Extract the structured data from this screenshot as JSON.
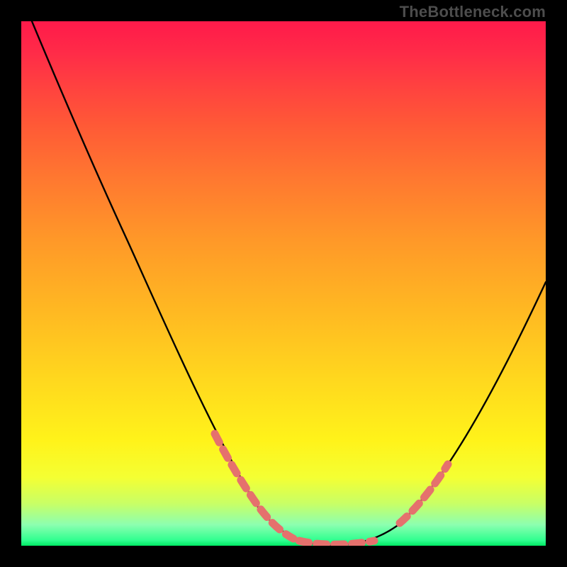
{
  "attribution": "TheBottleneck.com",
  "chart_data": {
    "type": "line",
    "title": "",
    "xlabel": "",
    "ylabel": "",
    "xlim": [
      0,
      100
    ],
    "ylim": [
      0,
      100
    ],
    "grid": false,
    "legend": false,
    "series": [
      {
        "name": "bottleneck-curve",
        "color": "#000000",
        "x": [
          2,
          5,
          10,
          15,
          20,
          25,
          30,
          35,
          40,
          45,
          50,
          53,
          56,
          60,
          65,
          70,
          75,
          80,
          85,
          90,
          95,
          100
        ],
        "y": [
          100,
          94,
          84,
          74,
          64,
          54,
          44,
          34,
          25,
          16,
          8,
          4,
          1,
          0,
          0,
          2,
          7,
          14,
          23,
          32,
          42,
          51
        ]
      },
      {
        "name": "highlight-left",
        "color": "#e5716d",
        "style": "dashed",
        "x": [
          38,
          40,
          42,
          44,
          46,
          48,
          50,
          52
        ],
        "y": [
          29,
          24,
          20,
          16,
          12,
          8,
          5,
          3
        ]
      },
      {
        "name": "highlight-bottom",
        "color": "#e5716d",
        "style": "dashed",
        "x": [
          53,
          56,
          59,
          62,
          65,
          68
        ],
        "y": [
          1,
          0,
          0,
          0,
          0,
          1
        ]
      },
      {
        "name": "highlight-right",
        "color": "#e5716d",
        "style": "dashed",
        "x": [
          73,
          75,
          77,
          79,
          81
        ],
        "y": [
          5,
          8,
          11,
          14,
          17
        ]
      }
    ],
    "annotations": []
  }
}
